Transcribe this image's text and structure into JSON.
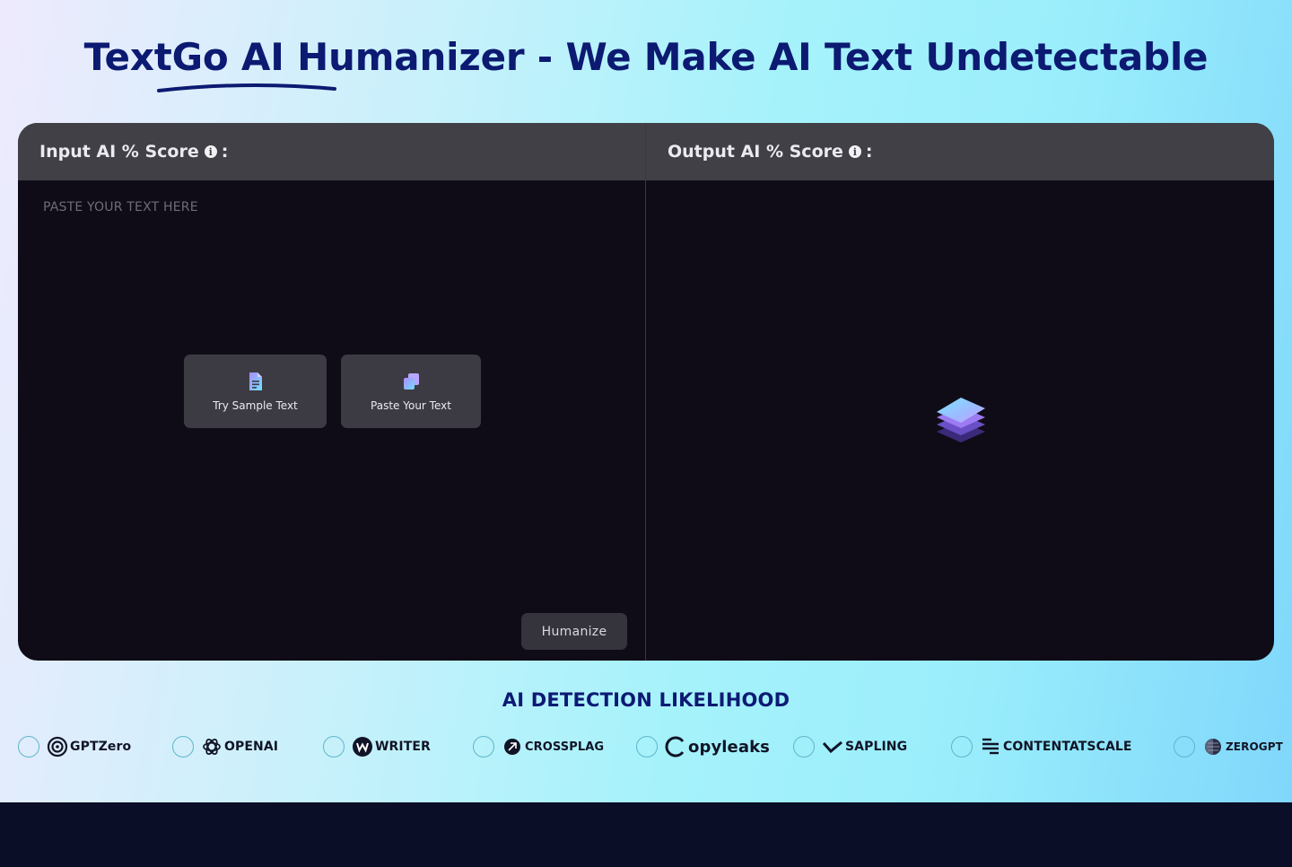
{
  "page": {
    "title": "TextGo AI Humanizer - We Make AI Text Undetectable"
  },
  "input_panel": {
    "header": "Input AI % Score",
    "info_icon": "info-icon",
    "colon": ":",
    "placeholder": "PASTE YOUR TEXT HERE",
    "sample_button": "Try Sample Text",
    "sample_icon": "document-icon",
    "paste_button": "Paste Your Text",
    "paste_icon": "copy-icon",
    "humanize_button": "Humanize"
  },
  "output_panel": {
    "header": "Output AI % Score",
    "colon": ":",
    "empty_state_icon": "layers-stack-icon"
  },
  "detection": {
    "title": "AI DETECTION LIKELIHOOD",
    "detectors": [
      {
        "label": "GPTZero",
        "icon": "gptzero-logo"
      },
      {
        "label": "OPENAI",
        "icon": "openai-logo"
      },
      {
        "label": "WRITER",
        "icon": "writer-logo"
      },
      {
        "label": "CROSSPLAG",
        "icon": "crossplag-logo"
      },
      {
        "label": "opyleaks",
        "icon": "copyleaks-logo"
      },
      {
        "label": "SAPLING",
        "icon": "sapling-logo"
      },
      {
        "label": "CONTENTATSCALE",
        "icon": "contentatscale-logo"
      },
      {
        "label": "ZEROGPT",
        "icon": "zerogpt-logo"
      }
    ]
  },
  "colors": {
    "title": "#0c1a72",
    "editor_bg": "#0f0c17",
    "header_bg": "#404046",
    "button_bg": "#3c3b43"
  }
}
